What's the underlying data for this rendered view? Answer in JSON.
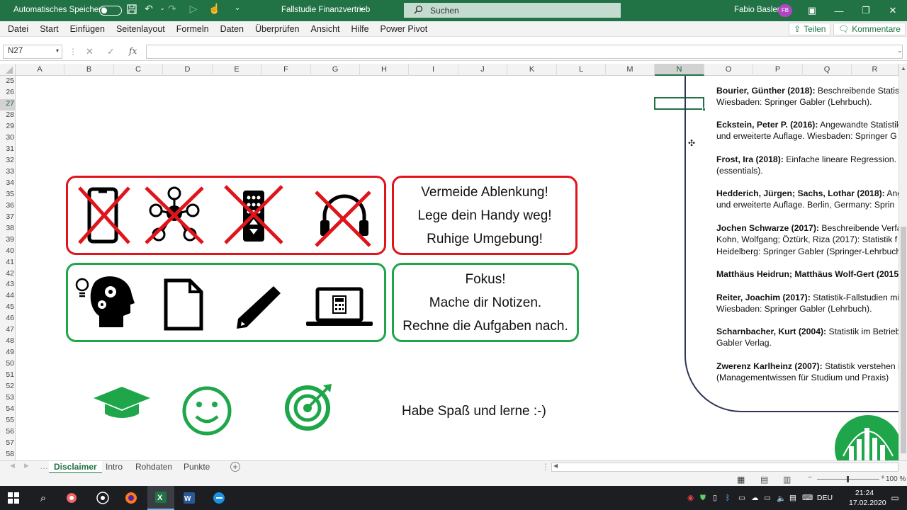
{
  "titlebar": {
    "autosave_label": "Automatisches Speichern",
    "document_title": "Fallstudie Finanzvertrieb",
    "search_placeholder": "Suchen",
    "user_name": "Fabio Basler",
    "user_initials": "FB",
    "accent_color": "#217346"
  },
  "menu": {
    "items": [
      "Datei",
      "Start",
      "Einfügen",
      "Seitenlayout",
      "Formeln",
      "Daten",
      "Überprüfen",
      "Ansicht",
      "Hilfe",
      "Power Pivot"
    ],
    "share_label": "Teilen",
    "comments_label": "Kommentare"
  },
  "formula_bar": {
    "name_box": "N27",
    "fx_label": "fx",
    "formula_value": ""
  },
  "columns": [
    "A",
    "B",
    "C",
    "D",
    "E",
    "F",
    "G",
    "H",
    "I",
    "J",
    "K",
    "L",
    "M",
    "N",
    "O",
    "P",
    "Q",
    "R"
  ],
  "selected_column": "N",
  "rows": [
    "25",
    "26",
    "27",
    "28",
    "29",
    "30",
    "31",
    "32",
    "33",
    "34",
    "35",
    "36",
    "37",
    "38",
    "39",
    "40",
    "41",
    "42",
    "43",
    "44",
    "45",
    "46",
    "47",
    "48",
    "49",
    "50",
    "51",
    "52",
    "53",
    "54",
    "55",
    "56",
    "57",
    "58"
  ],
  "sheet": {
    "avoid_icons": [
      "smartphone-icon",
      "social-network-icon",
      "remote-control-icon",
      "headphones-icon"
    ],
    "avoid_text": [
      "Vermeide Ablenkung!",
      "Lege dein Handy weg!",
      "Ruhige Umgebung!"
    ],
    "focus_icons": [
      "brain-gears-icon",
      "document-icon",
      "pencil-icon",
      "laptop-calculator-icon"
    ],
    "focus_text": [
      "Fokus!",
      "Mache dir Notizen.",
      "Rechne die Aufgaben nach."
    ],
    "fun_text": "Habe Spaß und lerne :-)",
    "fun_icons": [
      "graduation-cap-icon",
      "smiley-icon",
      "target-icon"
    ],
    "red": "#e0141b",
    "green": "#1fa64b"
  },
  "references": [
    {
      "author": "Bourier, Günther (2018):",
      "text": " Beschreibende Statis",
      "line2": "Wiesbaden: Springer Gabler (Lehrbuch)."
    },
    {
      "author": "Eckstein, Peter P. (2016):",
      "text": " Angewandte Statistik",
      "line2": "und erweiterte Auflage. Wiesbaden: Springer G"
    },
    {
      "author": "Frost, Ira (2018):",
      "text": " Einfache lineare Regression. D",
      "line2": "(essentials)."
    },
    {
      "author": "Hedderich, Jürgen; Sachs, Lothar (2018):",
      "text": " Ange",
      "line2": "und erweiterte Auflage. Berlin, Germany: Sprin"
    },
    {
      "author": "Jochen Schwarze (2017):",
      "text": " Beschreibende Verfal",
      "line2": "Kohn, Wolfgang; Öztürk, Riza (2017): Statistik f",
      "line3": "Heidelberg: Springer Gabler (Springer-Lehrbuch"
    },
    {
      "author": "Matthäus Heidrun; Matthäus Wolf-Gert (2015",
      "text": "",
      "line2": ""
    },
    {
      "author": "Reiter, Joachim (2017):",
      "text": " Statistik-Fallstudien mi",
      "line2": "Wiesbaden: Springer Gabler (Lehrbuch)."
    },
    {
      "author": "Scharnbacher, Kurt (2004):",
      "text": " Statistik im Betrieb",
      "line2": "Gabler Verlag."
    },
    {
      "author": "Zwerenz Karlheinz (2007):",
      "text": " Statistik verstehen i",
      "line2": "(Managementwissen für Studium und Praxis)"
    }
  ],
  "sheet_tabs": [
    "Disclaimer",
    "Intro",
    "Rohdaten",
    "Punkte"
  ],
  "active_tab": "Disclaimer",
  "status": {
    "zoom": "100 %"
  },
  "taskbar": {
    "time": "21:24",
    "date": "17.02.2020",
    "language": "DEU"
  }
}
